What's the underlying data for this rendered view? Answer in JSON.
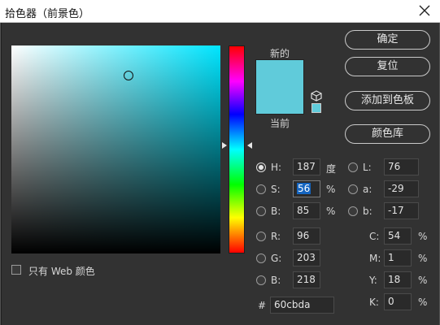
{
  "window": {
    "title": "拾色器（前景色）"
  },
  "preview": {
    "new_label": "新的",
    "current_label": "当前",
    "new_color": "#60cbda",
    "current_color": "#60cbda"
  },
  "buttons": {
    "ok": "确定",
    "reset": "复位",
    "add_to_swatches": "添加到色板",
    "color_libraries": "颜色库"
  },
  "hsb": {
    "h": {
      "label": "H:",
      "value": "187",
      "unit": "度"
    },
    "s": {
      "label": "S:",
      "value": "56",
      "unit": "%"
    },
    "b": {
      "label": "B:",
      "value": "85",
      "unit": "%"
    }
  },
  "rgb": {
    "r": {
      "label": "R:",
      "value": "96"
    },
    "g": {
      "label": "G:",
      "value": "203"
    },
    "b": {
      "label": "B:",
      "value": "218"
    }
  },
  "lab": {
    "l": {
      "label": "L:",
      "value": "76"
    },
    "a": {
      "label": "a:",
      "value": "-29"
    },
    "b": {
      "label": "b:",
      "value": "-17"
    }
  },
  "cmyk": {
    "c": {
      "label": "C:",
      "value": "54",
      "unit": "%"
    },
    "m": {
      "label": "M:",
      "value": "1",
      "unit": "%"
    },
    "y": {
      "label": "Y:",
      "value": "18",
      "unit": "%"
    },
    "k": {
      "label": "K:",
      "value": "0",
      "unit": "%"
    }
  },
  "hex": {
    "label": "#",
    "value": "60cbda"
  },
  "web_only": {
    "label": "只有 Web 颜色",
    "checked": false
  },
  "selected_mode": "H",
  "icons": {
    "close": "close-icon",
    "cube": "web-safe-cube-icon"
  }
}
